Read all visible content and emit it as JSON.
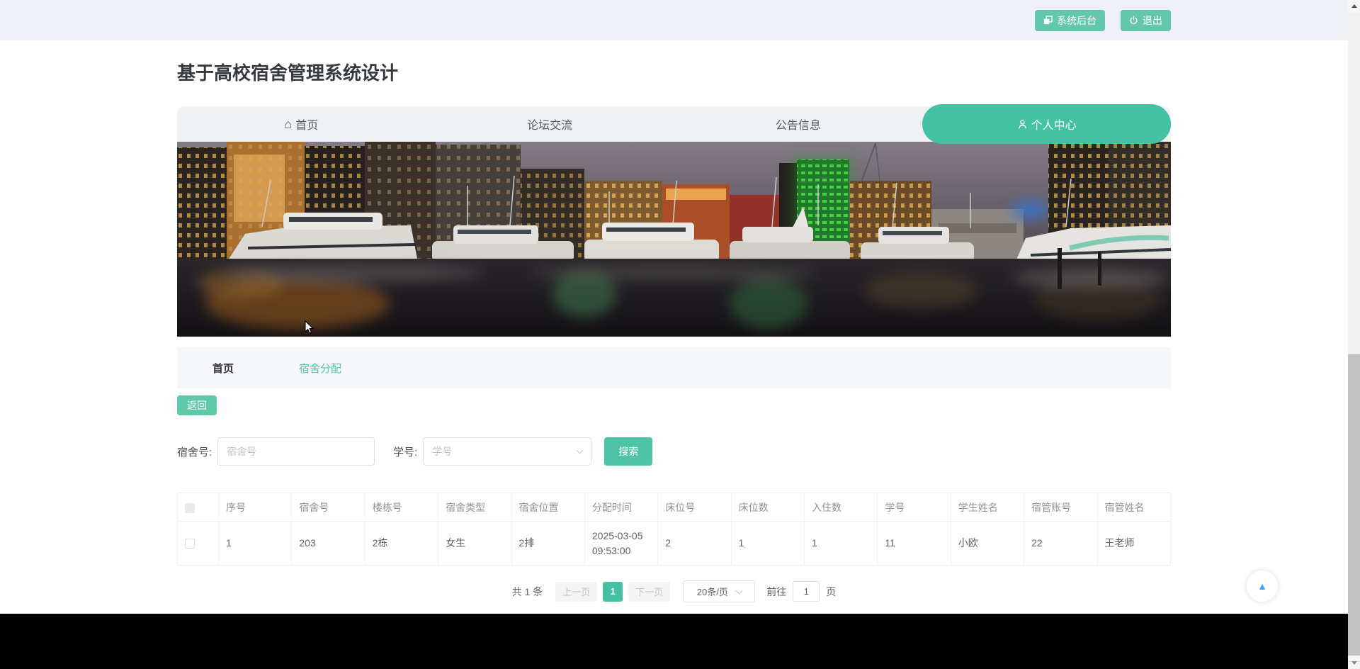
{
  "topbar": {
    "admin_label": "系统后台",
    "logout_label": "退出"
  },
  "header": {
    "title": "基于高校宿舍管理系统设计"
  },
  "nav": {
    "tabs": [
      {
        "label": "首页",
        "icon": "home-icon"
      },
      {
        "label": "论坛交流"
      },
      {
        "label": "公告信息"
      },
      {
        "label": "个人中心",
        "icon": "user-icon",
        "active": true
      }
    ]
  },
  "breadcrumb": {
    "items": [
      "首页",
      "宿舍分配"
    ]
  },
  "actions": {
    "back_label": "返回"
  },
  "search": {
    "dorm_label": "宿舍号:",
    "dorm_placeholder": "宿舍号",
    "student_label": "学号:",
    "student_placeholder": "学号",
    "submit_label": "搜索"
  },
  "table": {
    "columns": [
      "序号",
      "宿舍号",
      "楼栋号",
      "宿舍类型",
      "宿舍位置",
      "分配时间",
      "床位号",
      "床位数",
      "入住数",
      "学号",
      "学生姓名",
      "宿管账号",
      "宿管姓名"
    ],
    "rows": [
      [
        "1",
        "203",
        "2栋",
        "女生",
        "2排",
        "2025-03-05 09:53:00",
        "2",
        "1",
        "1",
        "11",
        "小欧",
        "22",
        "王老师"
      ]
    ]
  },
  "pagination": {
    "total_label": "共 1 条",
    "prev_label": "上一页",
    "current_page": "1",
    "next_label": "下一页",
    "page_size_label": "20条/页",
    "goto_label": "前往",
    "goto_value": "1",
    "page_unit_label": "页"
  },
  "icons": {
    "home_glyph": "⌂",
    "backtop_glyph": "▲"
  },
  "colors": {
    "accent": "#45c1a3",
    "accent_soft": "#62c7ab",
    "link": "#54c3a6",
    "topbar_bg": "#eef1f5",
    "tabs_bg": "#eff1f4",
    "breadcrumb_bg": "#f5f7f9",
    "table_border": "#ebeef5",
    "footer_bg": "#000000",
    "backtop_arrow": "#409eff"
  }
}
